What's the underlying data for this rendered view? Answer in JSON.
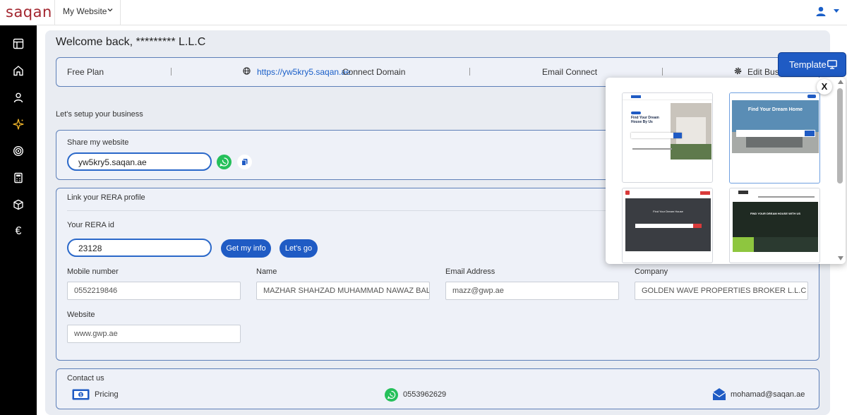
{
  "header": {
    "logo": "saqan",
    "site_selector": "My Website"
  },
  "sidebar": {
    "icons": [
      "dashboard-icon",
      "home-icon",
      "user-icon",
      "sparkle-icon",
      "target-icon",
      "calculator-icon",
      "box-icon",
      "euro-icon"
    ]
  },
  "welcome": "Welcome back, ********* L.L.C",
  "plan_bar": {
    "plan": "Free Plan",
    "url": "https://yw5kry5.saqan.ae",
    "connect_domain": "Connect Domain",
    "email_connect": "Email Connect",
    "edit_business": "Edit Busi"
  },
  "setup": {
    "title": "Let's setup your business",
    "share": {
      "title": "Share my website",
      "value": "yw5kry5.saqan.ae"
    },
    "rera": {
      "title": "Link your RERA profile",
      "id_label": "Your RERA id",
      "id_value": "23128",
      "get_info": "Get my info",
      "lets_go": "Let's go"
    },
    "fields": {
      "mobile_label": "Mobile number",
      "mobile_value": "0552219846",
      "name_label": "Name",
      "name_value": "MAZHAR SHAHZAD MUHAMMAD NAWAZ BAL",
      "email_label": "Email Address",
      "email_value": "mazz@gwp.ae",
      "company_label": "Company",
      "company_value": "GOLDEN WAVE PROPERTIES BROKER L.L.C",
      "website_label": "Website",
      "website_value": "www.gwp.ae"
    }
  },
  "contact": {
    "title": "Contact us",
    "pricing": "Pricing",
    "phone": "0553962629",
    "email": "mohamad@saqan.ae"
  },
  "template": {
    "button": "Template",
    "close": "X",
    "thumbnails": [
      {
        "headline": "Find Your Dream House By Us"
      },
      {
        "headline": "Find Your Dream Home"
      },
      {
        "headline": "Find Your Dream House"
      },
      {
        "headline": "FIND YOUR DREAM HOUSE WITH US"
      }
    ]
  },
  "colors": {
    "brand": "#a3262f",
    "accent": "#1f5bc4",
    "whatsapp": "#25c05a"
  }
}
